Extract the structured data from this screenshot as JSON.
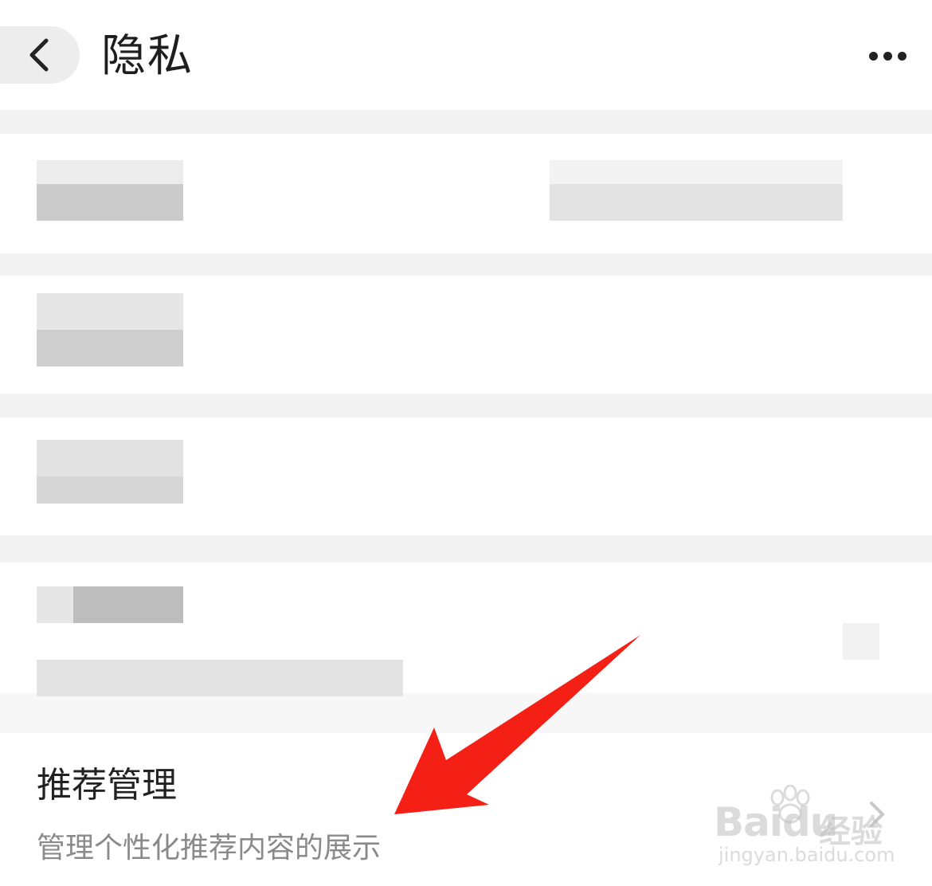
{
  "header": {
    "title": "隐私",
    "back_icon": "chevron-left-icon",
    "more_icon": "more-horizontal-icon"
  },
  "recommend": {
    "title": "推荐管理",
    "subtitle": "管理个性化推荐内容的展示",
    "chevron_icon": "chevron-right-icon"
  },
  "watermark": {
    "brand": "Bai",
    "brand_suffix": "du",
    "cn": "经验",
    "url": "jingyan.baidu.com"
  },
  "colors": {
    "annotation_arrow": "#f42015",
    "divider": "#f3f3f3",
    "subtitle": "#8a8a8a"
  }
}
